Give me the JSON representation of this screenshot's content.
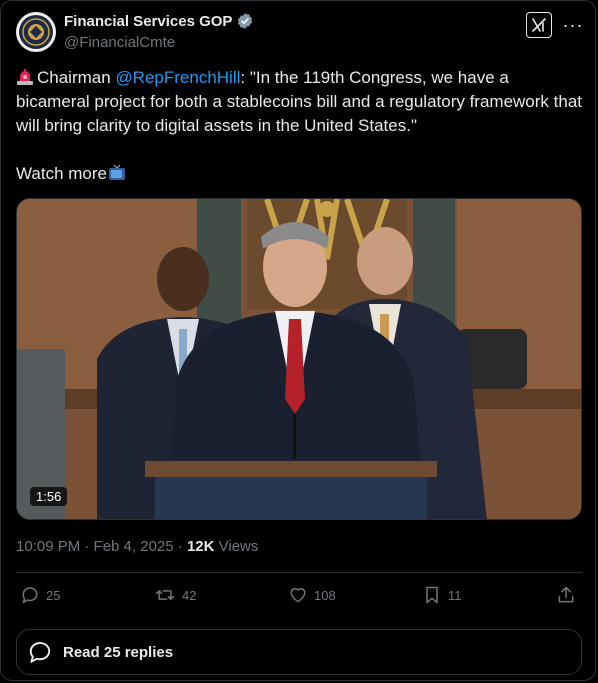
{
  "author": {
    "name": "Financial Services GOP",
    "handle": "@FinancialCmte",
    "verified_color": "#829aab"
  },
  "tweet": {
    "prefix": "Chairman ",
    "mention": "@RepFrenchHill",
    "body": ": \"In the 119th Congress, we have a bicameral project for both a stablecoins bill and a regulatory framework that will bring clarity to digital assets in the United States.\"",
    "watch_more": "Watch more"
  },
  "media": {
    "duration": "1:56"
  },
  "meta": {
    "time": "10:09 PM · Feb 4, 2025 · ",
    "views_count": "12K",
    "views_label": " Views"
  },
  "actions": {
    "replies": "25",
    "retweets": "42",
    "likes": "108",
    "bookmarks": "11"
  },
  "read_replies": "Read 25 replies",
  "colors": {
    "accent": "#1d9bf0",
    "text": "#e7e9ea",
    "muted": "#71767b",
    "border": "#2f3336"
  }
}
